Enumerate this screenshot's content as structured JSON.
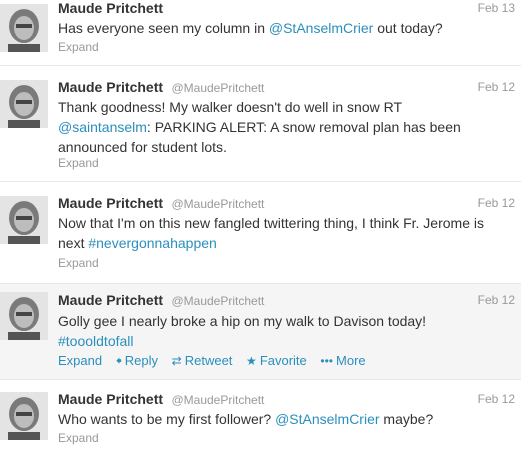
{
  "tweets": [
    {
      "fullname": "Maude Pritchett",
      "username": "",
      "time": "Feb 13",
      "text_parts": [
        {
          "t": "Has everyone seen my column in "
        },
        {
          "t": "@StAnselmCrier",
          "link": true
        },
        {
          "t": " out today?"
        }
      ],
      "expand": "Expand"
    },
    {
      "fullname": "Maude Pritchett",
      "username": "@MaudePritchett",
      "time": "Feb 12",
      "text_parts": [
        {
          "t": "Thank goodness! My walker doesn't do well in snow RT "
        },
        {
          "t": "@saintanselm",
          "link": true
        },
        {
          "t": ": PARKING ALERT: A snow removal plan has been announced for student lots."
        }
      ],
      "expand": "Expand"
    },
    {
      "fullname": "Maude Pritchett",
      "username": "@MaudePritchett",
      "time": "Feb 12",
      "text_parts": [
        {
          "t": "Now that I'm on this new fangled twittering thing, I think Fr. Jerome is next "
        },
        {
          "t": "#nevergonnahappen",
          "link": true
        }
      ],
      "expand": "Expand"
    },
    {
      "fullname": "Maude Pritchett",
      "username": "@MaudePritchett",
      "time": "Feb 12",
      "text_parts": [
        {
          "t": "Golly gee I nearly broke a hip on my walk to Davison today! "
        },
        {
          "t": "#toooldtofall",
          "link": true
        }
      ],
      "expand": "Expand",
      "actions": {
        "reply": "Reply",
        "retweet": "Retweet",
        "favorite": "Favorite",
        "more": "More"
      }
    },
    {
      "fullname": "Maude Pritchett",
      "username": "@MaudePritchett",
      "time": "Feb 12",
      "text_parts": [
        {
          "t": "Who wants to be my first follower? "
        },
        {
          "t": "@StAnselmCrier",
          "link": true
        },
        {
          "t": " maybe?"
        }
      ],
      "expand": "Expand"
    }
  ],
  "icons": {
    "reply": "reply-arrow-icon",
    "retweet": "retweet-icon",
    "favorite": "star-icon",
    "more": "more-dots-icon"
  },
  "colors": {
    "link": "#2a8fbd",
    "muted": "#999999",
    "text": "#333333",
    "hover_bg": "#f5f5f5"
  }
}
